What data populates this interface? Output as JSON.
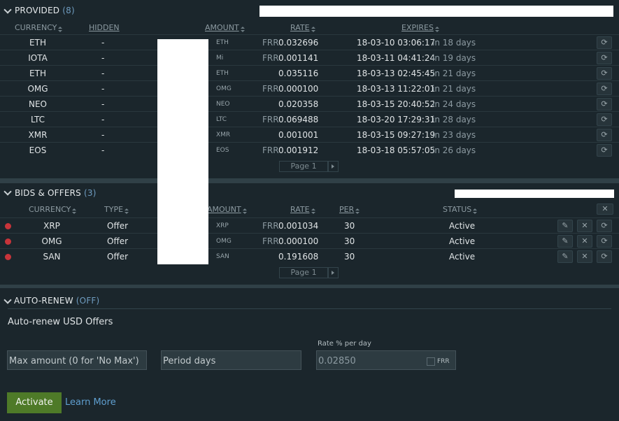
{
  "provided": {
    "title": "PROVIDED",
    "count": "(8)",
    "columns": {
      "currency": "CURRENCY",
      "hidden": "HIDDEN",
      "amount": "AMOUNT",
      "rate": "RATE",
      "expires": "EXPIRES"
    },
    "rows": [
      {
        "currency": "ETH",
        "hidden": "-",
        "unit": "ETH",
        "frr": "FRR",
        "rate": "0.032696",
        "date": "18-03-10 03:06:17",
        "rel": "in 18 days"
      },
      {
        "currency": "IOTA",
        "hidden": "-",
        "unit": "Mi",
        "frr": "FRR",
        "rate": "0.001141",
        "date": "18-03-11 04:41:24",
        "rel": "in 19 days"
      },
      {
        "currency": "ETH",
        "hidden": "-",
        "unit": "ETH",
        "frr": "",
        "rate": "0.035116",
        "date": "18-03-13 02:45:45",
        "rel": "in 21 days"
      },
      {
        "currency": "OMG",
        "hidden": "-",
        "unit": "OMG",
        "frr": "FRR",
        "rate": "0.000100",
        "date": "18-03-13 11:22:01",
        "rel": "in 21 days"
      },
      {
        "currency": "NEO",
        "hidden": "-",
        "unit": "NEO",
        "frr": "",
        "rate": "0.020358",
        "date": "18-03-15 20:40:52",
        "rel": "in 24 days"
      },
      {
        "currency": "LTC",
        "hidden": "-",
        "unit": "LTC",
        "frr": "FRR",
        "rate": "0.069488",
        "date": "18-03-20 17:29:31",
        "rel": "in 28 days"
      },
      {
        "currency": "XMR",
        "hidden": "-",
        "unit": "XMR",
        "frr": "",
        "rate": "0.001001",
        "date": "18-03-15 09:27:19",
        "rel": "in 23 days"
      },
      {
        "currency": "EOS",
        "hidden": "-",
        "unit": "EOS",
        "frr": "FRR",
        "rate": "0.001912",
        "date": "18-03-18 05:57:05",
        "rel": "in 26 days"
      }
    ],
    "pager": "Page 1"
  },
  "bids": {
    "title": "BIDS & OFFERS",
    "count": "(3)",
    "columns": {
      "currency": "CURRENCY",
      "type": "TYPE",
      "amount": "AMOUNT",
      "rate": "RATE",
      "per": "PER",
      "status": "STATUS"
    },
    "rows": [
      {
        "currency": "XRP",
        "type": "Offer",
        "unit": "XRP",
        "frr": "FRR",
        "rate": "0.001034",
        "per": "30",
        "status": "Active"
      },
      {
        "currency": "OMG",
        "type": "Offer",
        "unit": "OMG",
        "frr": "FRR",
        "rate": "0.000100",
        "per": "30",
        "status": "Active"
      },
      {
        "currency": "SAN",
        "type": "Offer",
        "unit": "SAN",
        "frr": "",
        "rate": "0.191608",
        "per": "30",
        "status": "Active"
      }
    ],
    "pager": "Page 1"
  },
  "autorenew": {
    "title": "AUTO-RENEW",
    "state": "(OFF)",
    "subtitle": "Auto-renew USD Offers",
    "max_placeholder": "Max amount (0 for 'No Max')",
    "period_placeholder": "Period days",
    "rate_label": "Rate % per day",
    "rate_value": "0.02850",
    "frr_label": "FRR",
    "activate": "Activate",
    "learn_more": "Learn More"
  },
  "icons": {
    "refresh": "refresh-icon",
    "edit": "pencil-icon",
    "cancel": "close-icon",
    "chevron": "chevron-down-icon"
  },
  "colors": {
    "accent_green": "#4e7a28",
    "link": "#5f9fd0",
    "status_dot": "#c8343a",
    "count": "#6f9cc0"
  }
}
